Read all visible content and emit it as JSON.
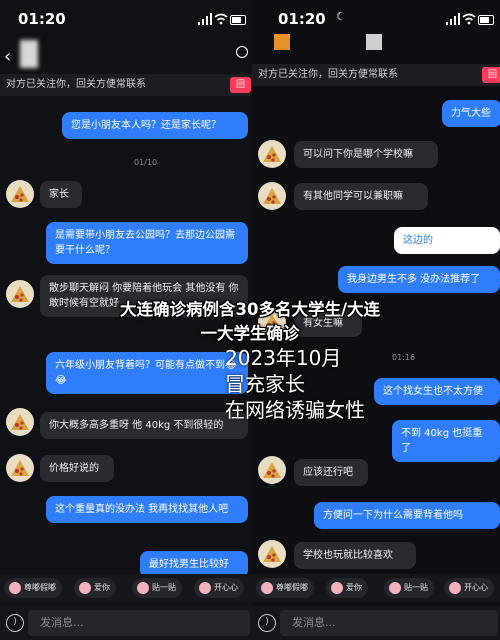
{
  "left": {
    "status_time": "01:20",
    "notice": "对方已关注你，回关方便常联系",
    "notice_button": "回",
    "timestamp": "01/10",
    "messages": [
      {
        "side": "out",
        "text": "您是小朋友本人吗？还是家长呢？"
      },
      {
        "side": "in",
        "text": "家长"
      },
      {
        "side": "out",
        "text": "是需要带小朋友去公园吗？去那边公园需要干什么呢？"
      },
      {
        "side": "in",
        "text": "散步聊天解闷 你要陪着他玩会 其他没有 你敢时候有空就好"
      },
      {
        "side": "out",
        "text": "六年级小朋友背着吗？可能有点做不到😂😂"
      },
      {
        "side": "in",
        "text": "你大概多高多重呀 他 40kg 不到很轻的"
      },
      {
        "side": "in",
        "text": "价格好说的"
      },
      {
        "side": "out",
        "text": "这个重量真的没办法 我再找找其他人吧"
      },
      {
        "side": "out",
        "text": "最好找男生比较好"
      }
    ],
    "chips": [
      "尊嘟假嘟",
      "爱你",
      "贴一贴",
      "开心心"
    ],
    "input_placeholder": "发消息..."
  },
  "right": {
    "status_time": "01:20",
    "notice": "对方已关注你，回关方便常联系",
    "notice_button": "回",
    "timestamp": "01:16",
    "messages": [
      {
        "side": "out",
        "text": "力气大些"
      },
      {
        "side": "in",
        "text": "可以问下你是哪个学校嘛"
      },
      {
        "side": "in",
        "text": "有其他同学可以兼职嘛"
      },
      {
        "side": "out",
        "text": "这边的"
      },
      {
        "side": "out",
        "text": "我身边男生不多 没办法推荐了"
      },
      {
        "side": "in",
        "text": "有女生嘛"
      },
      {
        "side": "out",
        "text": "这个找女生也不太方便"
      },
      {
        "side": "out",
        "text": "不到 40kg 也挺重了"
      },
      {
        "side": "in",
        "text": "应该还行吧"
      },
      {
        "side": "out",
        "text": "方便问一下为什么需要背着他吗"
      },
      {
        "side": "in",
        "text": "学校也玩就比较喜欢"
      }
    ],
    "chips": [
      "尊嘟假嘟",
      "爱你",
      "贴一贴",
      "开心心"
    ],
    "input_placeholder": "发消息..."
  },
  "overlay": {
    "headline_line1": "大连确诊病例含30多名大学生/大连",
    "headline_line2": "一大学生确诊",
    "watermark_line1": "2023年10月",
    "watermark_line2": "冒充家长",
    "watermark_line3": "在网络诱骗女性"
  }
}
